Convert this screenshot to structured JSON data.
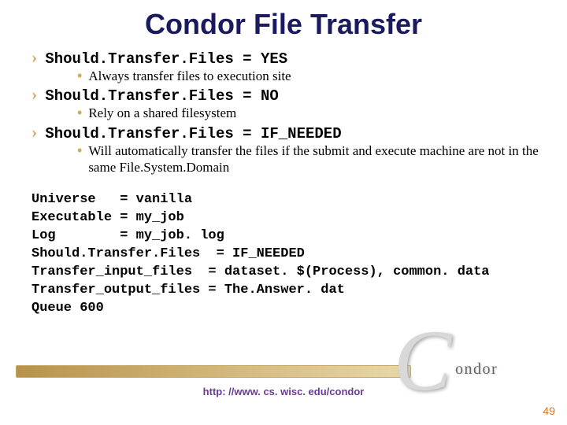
{
  "title": "Condor File Transfer",
  "items": [
    {
      "label": "Should.Transfer.Files = YES",
      "sub": [
        "Always transfer files to execution site"
      ]
    },
    {
      "label": "Should.Transfer.Files = NO",
      "sub": [
        "Rely on a shared filesystem"
      ]
    },
    {
      "label": "Should.Transfer.Files = IF_NEEDED",
      "sub": [
        "Will automatically transfer the files if the submit and execute machine are not in the same File.System.Domain"
      ]
    }
  ],
  "code": "Universe   = vanilla\nExecutable = my_job\nLog        = my_job. log\nShould.Transfer.Files  = IF_NEEDED\nTransfer_input_files  = dataset. $(Process), common. data\nTransfer_output_files = The.Answer. dat\nQueue 600",
  "url": "http: //www. cs. wisc. edu/condor",
  "page": "49",
  "logo": {
    "word": "ondor"
  }
}
